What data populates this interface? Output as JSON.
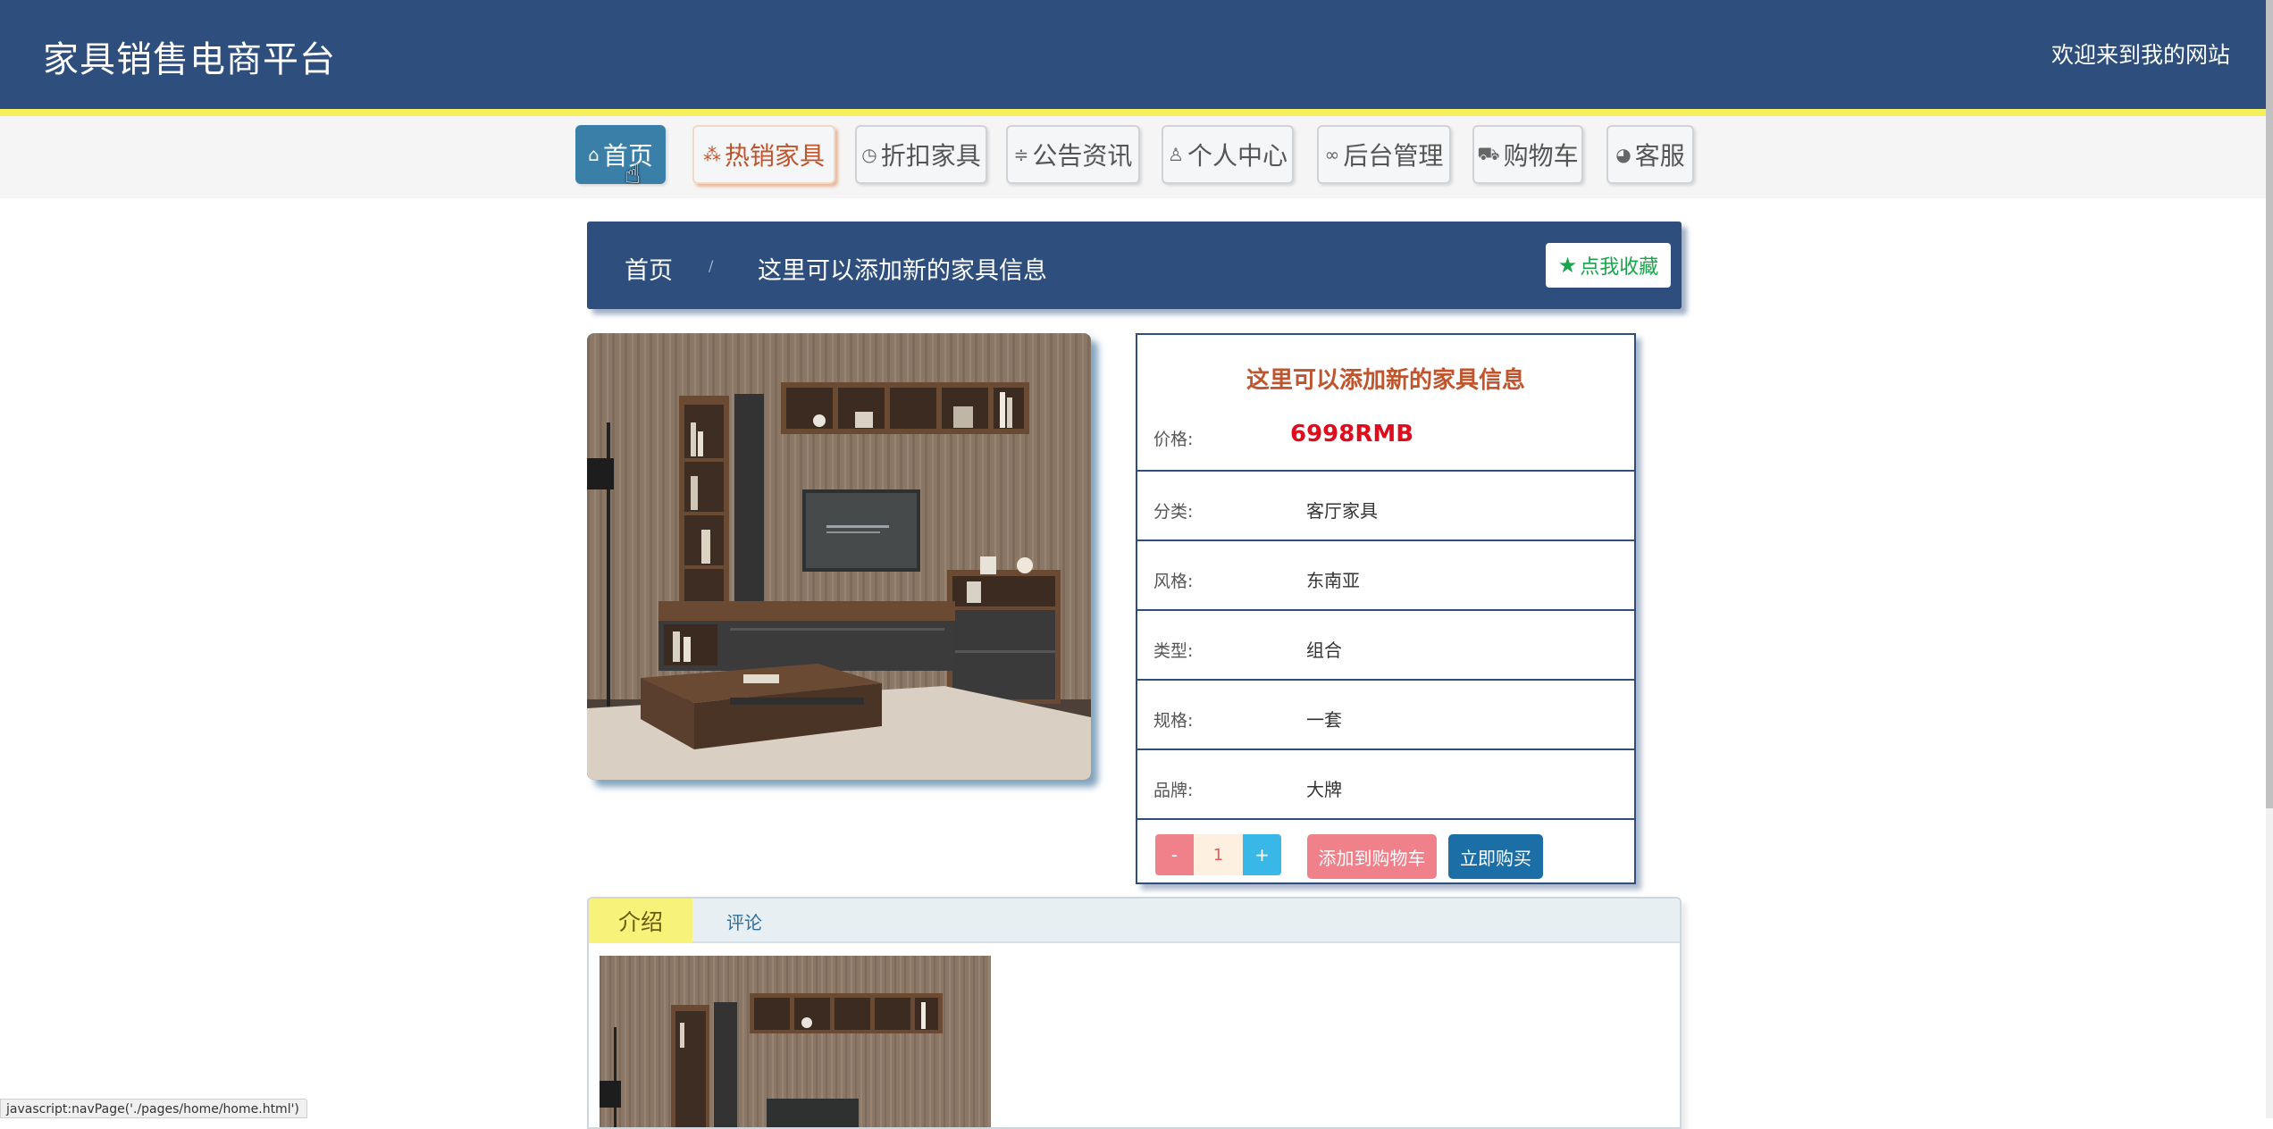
{
  "header": {
    "site_title": "家具销售电商平台",
    "welcome": "欢迎来到我的网站"
  },
  "nav": {
    "items": [
      {
        "label": "首页",
        "icon": "home-icon",
        "state": "active"
      },
      {
        "label": "热销家具",
        "icon": "fire-icon",
        "state": "hot"
      },
      {
        "label": "折扣家具",
        "icon": "clock-icon",
        "state": "normal"
      },
      {
        "label": "公告资讯",
        "icon": "sliders-icon",
        "state": "normal"
      },
      {
        "label": "个人中心",
        "icon": "user-icon",
        "state": "normal"
      },
      {
        "label": "后台管理",
        "icon": "link-icon",
        "state": "normal"
      },
      {
        "label": "购物车",
        "icon": "cart-icon",
        "state": "normal"
      },
      {
        "label": "客服",
        "icon": "chat-icon",
        "state": "normal"
      }
    ]
  },
  "breadcrumb": {
    "home": "首页",
    "separator": "/",
    "current": "这里可以添加新的家具信息"
  },
  "favorite": {
    "label": "点我收藏",
    "icon": "star-icon"
  },
  "product": {
    "title": "这里可以添加新的家具信息",
    "price_label": "价格:",
    "price": "6998RMB",
    "specs": [
      {
        "label": "分类:",
        "value": "客厅家具"
      },
      {
        "label": "风格:",
        "value": "东南亚"
      },
      {
        "label": "类型:",
        "value": "组合"
      },
      {
        "label": "规格:",
        "value": "一套"
      },
      {
        "label": "品牌:",
        "value": "大牌"
      }
    ],
    "quantity": {
      "minus": "-",
      "value": "1",
      "plus": "+"
    },
    "add_to_cart": "添加到购物车",
    "buy_now": "立即购买"
  },
  "tabs": [
    {
      "label": "介绍",
      "active": true
    },
    {
      "label": "评论",
      "active": false
    }
  ],
  "status_bar": "javascript:navPage('./pages/home/home.html')",
  "colors": {
    "header": "#2e4e7e",
    "accent_yellow": "#f4ef5a",
    "price_red": "#e00b1c",
    "title_orange": "#c0542c",
    "fav_green": "#19a54c"
  }
}
